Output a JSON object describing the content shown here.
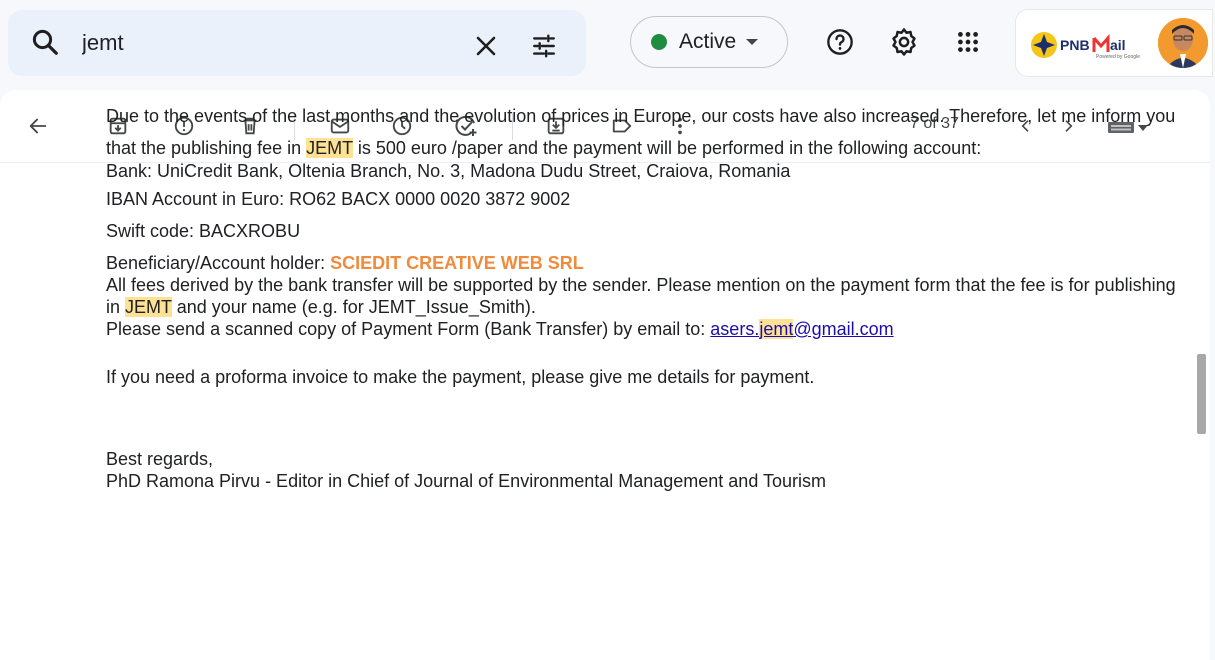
{
  "search": {
    "query": "jemt",
    "placeholder": ""
  },
  "status": {
    "label": "Active",
    "color": "#1e8e3e"
  },
  "account": {
    "logo_text_a": "PNB",
    "logo_text_b": "ail",
    "logo_sub": "Powered by Google"
  },
  "pager": {
    "text": "7 of 37"
  },
  "icons": {
    "search": "search-icon",
    "clear": "close-icon",
    "options": "tune-icon",
    "help": "help-icon",
    "settings": "gear-icon",
    "apps": "apps-grid-icon",
    "back": "arrow-back-icon",
    "archive": "archive-icon",
    "spam": "report-icon",
    "delete": "trash-icon",
    "unread": "mail-icon",
    "snooze": "clock-icon",
    "task": "add-task-icon",
    "move": "move-to-icon",
    "label": "label-icon",
    "more": "more-vert-icon",
    "prev": "chevron-left-icon",
    "next": "chevron-right-icon",
    "keyboard": "keyboard-icon"
  },
  "email": {
    "p1_a": "Due to the events of the last months and the evolution of prices in Europe, our costs have also increased. Therefore, let me inform you that the publishing fee in ",
    "p1_hl": "JEMT",
    "p1_b": " is 500 euro /paper and the payment will be performed in the following account:",
    "bank": "Bank: UniCredit Bank, Oltenia Branch, No. 3, Madona Dudu Street, Craiova, Romania",
    "iban": "IBAN Account in Euro: RO62 BACX 0000 0020 3872 9002",
    "swift": "Swift code: BACXROBU",
    "beneficiary_label": "Beneficiary/Account holder: ",
    "beneficiary_name": "SCIEDIT CREATIVE WEB SRL",
    "fees_a": "All fees derived by the bank transfer will be supported by the sender. Please mention on the payment form that the fee is for publishing in ",
    "fees_hl": "JEMT",
    "fees_b": " and your name (e.g. for JEMT_Issue_Smith).",
    "send_text": "Please send a scanned copy of Payment Form (Bank Transfer) by email to: ",
    "email_a": "asers.",
    "email_hl": "jemt",
    "email_b": "@gmail.com",
    "proforma": "If you need a proforma invoice to make the payment, please give me details for payment.",
    "regards": "Best regards,",
    "signature": "PhD Ramona Pirvu - Editor in Chief of Journal of Environmental Management and Tourism"
  }
}
